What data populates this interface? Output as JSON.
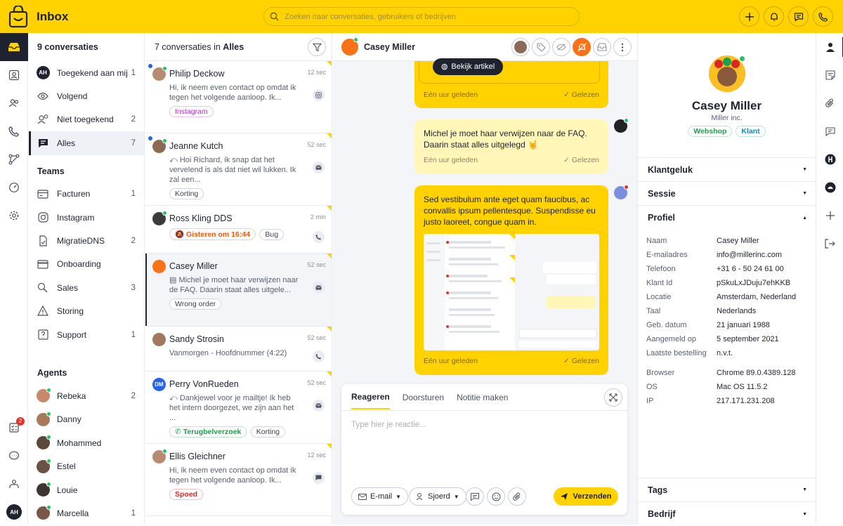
{
  "app": {
    "title": "Inbox"
  },
  "search": {
    "placeholder": "Zoeken naar conversaties, gebruikers of bedrijven"
  },
  "nav": {
    "header": "9 conversaties",
    "main": [
      {
        "label": "Toegekend aan mij",
        "count": "1",
        "avatar": "AH"
      },
      {
        "label": "Volgend",
        "count": ""
      },
      {
        "label": "Niet toegekend",
        "count": "2"
      },
      {
        "label": "Alles",
        "count": "7"
      }
    ],
    "teams_title": "Teams",
    "teams": [
      {
        "label": "Facturen",
        "count": "1"
      },
      {
        "label": "Instagram",
        "count": ""
      },
      {
        "label": "MigratieDNS",
        "count": "2"
      },
      {
        "label": "Onboarding",
        "count": ""
      },
      {
        "label": "Sales",
        "count": "3"
      },
      {
        "label": "Storing",
        "count": ""
      },
      {
        "label": "Support",
        "count": "1"
      }
    ],
    "agents_title": "Agents",
    "agents": [
      {
        "label": "Rebeka",
        "count": "2",
        "color": "#c7896b"
      },
      {
        "label": "Danny",
        "count": "",
        "color": "#a87a5c"
      },
      {
        "label": "Mohammed",
        "count": "",
        "color": "#5a4a3c"
      },
      {
        "label": "Estel",
        "count": "",
        "color": "#6b5245"
      },
      {
        "label": "Louie",
        "count": "",
        "color": "#3f3530"
      },
      {
        "label": "Marcella",
        "count": "1",
        "color": "#7a5848"
      }
    ]
  },
  "rail": {
    "badge": "2",
    "user": "AH"
  },
  "list": {
    "count_label": "7 conversaties in",
    "filter_name": "Alles",
    "items": [
      {
        "name": "Philip Deckow",
        "time": "12 sec",
        "snippet": "Hi, ik neem even contact op omdat ik tegen het volgende aanloop. Ik...",
        "tags": [
          "Instagram"
        ]
      },
      {
        "name": "Jeanne Kutch",
        "time": "52 sec",
        "snippet": "Hoi Richard, ik snap dat het vervelend is als dat niet wil lukken. Ik zal een...",
        "tags": [
          "Korting"
        ]
      },
      {
        "name": "Ross Kling DDS",
        "time": "2 min",
        "snippet": "",
        "tags": [
          "Gisteren om 16:44",
          "Bug"
        ]
      },
      {
        "name": "Casey Miller",
        "time": "52 sec",
        "snippet": "Michel je moet haar verwijzen naar de FAQ. Daarin staat alles uitgele...",
        "tags": [
          "Wrong order"
        ]
      },
      {
        "name": "Sandy Strosin",
        "time": "52 sec",
        "snippet": "Vanmorgen - Hoofdnummer (4:22)",
        "tags": []
      },
      {
        "name": "Perry VonRueden",
        "time": "52 sec",
        "snippet": "Dankjewel voor je mailtje! Ik heb het intern doorgezet, we zijn aan het ...",
        "tags": [
          "Terugbelverzoek",
          "Korting"
        ],
        "avatar": "DM"
      },
      {
        "name": "Ellis Gleichner",
        "time": "12 sec",
        "snippet": "Hi, ik neem even contact op omdat ik tegen het volgende aanloop. Ik...",
        "tags": [
          "Spoed"
        ]
      }
    ]
  },
  "chat": {
    "contact": "Casey Miller",
    "article_button": "Bekijk artikel",
    "messages": [
      {
        "text": "",
        "time": "Eén uur geleden",
        "status": "Gelezen"
      },
      {
        "text": "Michel je moet haar verwijzen naar de FAQ. Daarin staat alles uitgelegd 🤘",
        "time": "Eén uur geleden",
        "status": "Gelezen"
      },
      {
        "text": "Sed vestibulum ante eget quam faucibus, ac convallis ipsum pellentesque. Suspendisse eu justo laoreet, congue quam in.",
        "time": "Eén uur geleden",
        "status": "Gelezen"
      }
    ]
  },
  "reply": {
    "tabs": [
      "Reageren",
      "Doorsturen",
      "Notitie maken"
    ],
    "placeholder": "Type hier je reactie...",
    "channel": "E-mail",
    "agent": "Sjoerd",
    "send": "Verzenden"
  },
  "profile": {
    "name": "Casey Miller",
    "company": "Miller inc.",
    "tags": [
      "Webshop",
      "Klant"
    ],
    "sections": [
      "Klantgeluk",
      "Sessie",
      "Profiel"
    ],
    "fields": [
      {
        "k": "Naam",
        "v": "Casey Miller"
      },
      {
        "k": "E-mailadres",
        "v": "info@millerinc.com"
      },
      {
        "k": "Telefoon",
        "v": "+31 6 - 50 24 61 00"
      },
      {
        "k": "Klant Id",
        "v": "pSkuLxJDuju7ehKKB"
      },
      {
        "k": "Locatie",
        "v": "Amsterdam, Nederland"
      },
      {
        "k": "Taal",
        "v": "Nederlands"
      },
      {
        "k": "Geb. datum",
        "v": "21 januari 1988"
      },
      {
        "k": "Aangemeld op",
        "v": "5 september 2021"
      },
      {
        "k": "Laatste bestelling",
        "v": "n.v.t."
      }
    ],
    "tech": [
      {
        "k": "Browser",
        "v": "Chrome 89.0.4389.128"
      },
      {
        "k": "OS",
        "v": "Mac OS 11.5.2"
      },
      {
        "k": "IP",
        "v": "217.171.231.208"
      }
    ],
    "bottom_sections": [
      "Tags",
      "Bedrijf"
    ]
  },
  "colors": {
    "brand": "#ffd200",
    "dark": "#1f2330",
    "online": "#22c55e",
    "unread": "#2563eb"
  }
}
